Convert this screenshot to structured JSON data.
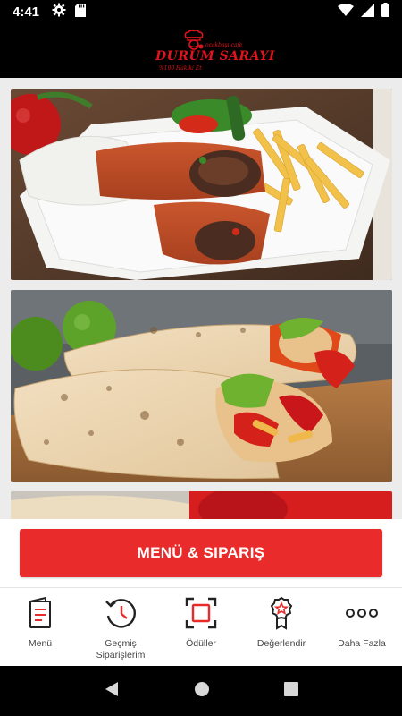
{
  "status_bar": {
    "time": "4:41",
    "icons_left": [
      "gear-icon",
      "sd-card-icon"
    ],
    "icons_right": [
      "wifi-icon",
      "signal-icon",
      "battery-icon"
    ]
  },
  "header": {
    "logo_name": "DURUM SARAYI",
    "logo_tagline": "ocakbaşı-cafe",
    "logo_sub": "%100 Hakiki Et",
    "brand_color": "#e0141c"
  },
  "gallery": {
    "photos": [
      "wrap-with-fries-photo",
      "chicken-wrap-photo",
      "wrap-photo-partial"
    ]
  },
  "cta": {
    "label": "MENÜ & SIPARIŞ",
    "color": "#e92b2b"
  },
  "bottom_nav": {
    "items": [
      {
        "label": "Menü",
        "icon": "menu-book-icon"
      },
      {
        "label": "Geçmiş Siparişlerim",
        "icon": "history-icon"
      },
      {
        "label": "Ödüller",
        "icon": "rewards-icon"
      },
      {
        "label": "Değerlendir",
        "icon": "rate-badge-icon"
      },
      {
        "label": "Daha Fazla",
        "icon": "more-icon"
      }
    ]
  },
  "system_nav": [
    "back-icon",
    "home-icon",
    "recents-icon"
  ]
}
